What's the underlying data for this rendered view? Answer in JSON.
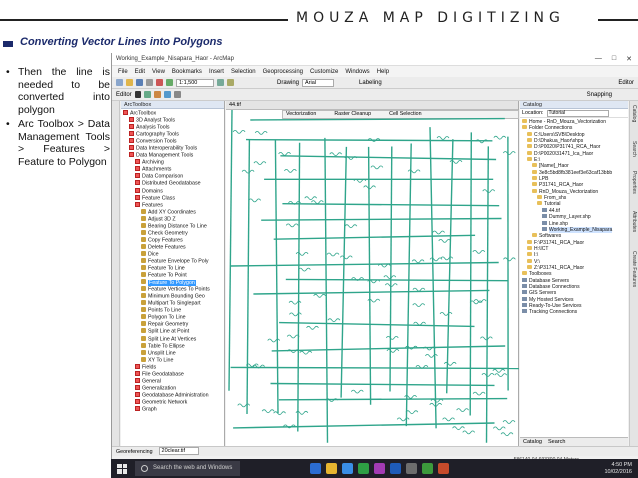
{
  "header": {
    "title": "MOUZA MAP DIGITIZING",
    "subtitle": "Converting Vector Lines into Polygons"
  },
  "bullets": [
    "Then the line is needed to be converted into polygon",
    "Arc Toolbox > Data Management Tools > Features > Feature to Polygon"
  ],
  "app": {
    "window_title": "Working_Example_Nisapara_Haor - ArcMap",
    "menu": [
      "File",
      "Edit",
      "View",
      "Bookmarks",
      "Insert",
      "Selection",
      "Geoprocessing",
      "Customize",
      "Windows",
      "Help"
    ],
    "scale": "1:1,500",
    "drawing_label": "Drawing",
    "font_name": "Arial",
    "labeling_label": "Labeling",
    "editor_label": "Editor",
    "snapping_label": "Snapping",
    "toolbox_title": "ArcToolbox",
    "toolbox_items": [
      {
        "label": "ArcToolbox",
        "indent": 0,
        "kind": "box"
      },
      {
        "label": "3D Analyst Tools",
        "indent": 1,
        "kind": "box"
      },
      {
        "label": "Analysis Tools",
        "indent": 1,
        "kind": "box"
      },
      {
        "label": "Cartography Tools",
        "indent": 1,
        "kind": "box"
      },
      {
        "label": "Conversion Tools",
        "indent": 1,
        "kind": "box"
      },
      {
        "label": "Data Interoperability Tools",
        "indent": 1,
        "kind": "box"
      },
      {
        "label": "Data Management Tools",
        "indent": 1,
        "kind": "box"
      },
      {
        "label": "Archiving",
        "indent": 2,
        "kind": "box"
      },
      {
        "label": "Attachments",
        "indent": 2,
        "kind": "box"
      },
      {
        "label": "Data Comparison",
        "indent": 2,
        "kind": "box"
      },
      {
        "label": "Distributed Geodatabase",
        "indent": 2,
        "kind": "box"
      },
      {
        "label": "Domains",
        "indent": 2,
        "kind": "box"
      },
      {
        "label": "Feature Class",
        "indent": 2,
        "kind": "box"
      },
      {
        "label": "Features",
        "indent": 2,
        "kind": "box"
      },
      {
        "label": "Add XY Coordinates",
        "indent": 3,
        "kind": "tool"
      },
      {
        "label": "Adjust 3D Z",
        "indent": 3,
        "kind": "tool"
      },
      {
        "label": "Bearing Distance To Line",
        "indent": 3,
        "kind": "tool"
      },
      {
        "label": "Check Geometry",
        "indent": 3,
        "kind": "tool"
      },
      {
        "label": "Copy Features",
        "indent": 3,
        "kind": "tool"
      },
      {
        "label": "Delete Features",
        "indent": 3,
        "kind": "tool"
      },
      {
        "label": "Dice",
        "indent": 3,
        "kind": "tool"
      },
      {
        "label": "Feature Envelope To Poly",
        "indent": 3,
        "kind": "tool"
      },
      {
        "label": "Feature To Line",
        "indent": 3,
        "kind": "tool"
      },
      {
        "label": "Feature To Point",
        "indent": 3,
        "kind": "tool"
      },
      {
        "label": "Feature To Polygon",
        "indent": 3,
        "kind": "tool",
        "selected": true
      },
      {
        "label": "Feature Vertices To Points",
        "indent": 3,
        "kind": "tool"
      },
      {
        "label": "Minimum Bounding Geo",
        "indent": 3,
        "kind": "tool"
      },
      {
        "label": "Multipart To Singlepart",
        "indent": 3,
        "kind": "tool"
      },
      {
        "label": "Points To Line",
        "indent": 3,
        "kind": "tool"
      },
      {
        "label": "Polygon To Line",
        "indent": 3,
        "kind": "tool"
      },
      {
        "label": "Repair Geometry",
        "indent": 3,
        "kind": "tool"
      },
      {
        "label": "Split Line at Point",
        "indent": 3,
        "kind": "tool"
      },
      {
        "label": "Split Line At Vertices",
        "indent": 3,
        "kind": "tool"
      },
      {
        "label": "Table To Ellipse",
        "indent": 3,
        "kind": "tool"
      },
      {
        "label": "Unsplit Line",
        "indent": 3,
        "kind": "tool"
      },
      {
        "label": "XY To Line",
        "indent": 3,
        "kind": "tool"
      },
      {
        "label": "Fields",
        "indent": 2,
        "kind": "box"
      },
      {
        "label": "File Geodatabase",
        "indent": 2,
        "kind": "box"
      },
      {
        "label": "General",
        "indent": 2,
        "kind": "box"
      },
      {
        "label": "Generalization",
        "indent": 2,
        "kind": "box"
      },
      {
        "label": "Geodatabase Administration",
        "indent": 2,
        "kind": "box"
      },
      {
        "label": "Geometric Network",
        "indent": 2,
        "kind": "box"
      },
      {
        "label": "Graph",
        "indent": 2,
        "kind": "box"
      }
    ],
    "map_tab": "44.tif",
    "vectorization_bar": [
      "Vectorization",
      "Raster Cleanup",
      "Cell Selection"
    ],
    "catalog_title": "Catalog",
    "location_label": "Location:",
    "location_value": "Tutorial",
    "catalog_items": [
      {
        "label": "Home - RnD_Mouza_Vectorization",
        "indent": 0,
        "kind": "folder"
      },
      {
        "label": "Folder Connections",
        "indent": 0,
        "kind": "folder"
      },
      {
        "label": "C:\\Users\\SVB\\Desktop",
        "indent": 1,
        "kind": "folder"
      },
      {
        "label": "D:\\Dhakua_Haor\\shps",
        "indent": 1,
        "kind": "folder"
      },
      {
        "label": "D:\\P0020\\P31741_RCA_Haor",
        "indent": 1,
        "kind": "folder"
      },
      {
        "label": "D:\\P0020\\31471_Ica_Haor",
        "indent": 1,
        "kind": "folder"
      },
      {
        "label": "E:\\",
        "indent": 1,
        "kind": "folder"
      },
      {
        "label": "[Name]_Haor",
        "indent": 2,
        "kind": "folder"
      },
      {
        "label": "3e8c5bd8fb381eef3e63caf13bbb",
        "indent": 2,
        "kind": "folder"
      },
      {
        "label": "LPB",
        "indent": 2,
        "kind": "folder"
      },
      {
        "label": "P31741_RCA_Haor",
        "indent": 2,
        "kind": "folder"
      },
      {
        "label": "RnD_Mouza_Vectorization",
        "indent": 2,
        "kind": "folder"
      },
      {
        "label": "From_shs",
        "indent": 3,
        "kind": "folder"
      },
      {
        "label": "Tutorial",
        "indent": 3,
        "kind": "folder"
      },
      {
        "label": "44.tif",
        "indent": 4,
        "kind": "data"
      },
      {
        "label": "Dummy_Layer.shp",
        "indent": 4,
        "kind": "data"
      },
      {
        "label": "Line.shp",
        "indent": 4,
        "kind": "data"
      },
      {
        "label": "Working_Example_Nisapara",
        "indent": 4,
        "kind": "data",
        "highlight": true
      },
      {
        "label": "Softwares",
        "indent": 2,
        "kind": "folder"
      },
      {
        "label": "F:\\P31741_RCA_Haor",
        "indent": 1,
        "kind": "folder"
      },
      {
        "label": "H:\\ICT",
        "indent": 1,
        "kind": "folder"
      },
      {
        "label": "I:\\",
        "indent": 1,
        "kind": "folder"
      },
      {
        "label": "V:\\",
        "indent": 1,
        "kind": "folder"
      },
      {
        "label": "Z:\\P31741_RCA_Haor",
        "indent": 1,
        "kind": "folder"
      },
      {
        "label": "Toolboxes",
        "indent": 0,
        "kind": "folder"
      },
      {
        "label": "Database Servers",
        "indent": 0,
        "kind": "data"
      },
      {
        "label": "Database Connections",
        "indent": 0,
        "kind": "data"
      },
      {
        "label": "GIS Servers",
        "indent": 0,
        "kind": "data"
      },
      {
        "label": "My Hosted Services",
        "indent": 0,
        "kind": "data"
      },
      {
        "label": "Ready-To-Use Services",
        "indent": 0,
        "kind": "data"
      },
      {
        "label": "Tracking Connections",
        "indent": 0,
        "kind": "data"
      }
    ],
    "catalog_tabs": [
      "Catalog",
      "Search"
    ],
    "right_tabs": [
      "Catalog",
      "Search",
      "Properties",
      "Attributes",
      "Create Features"
    ],
    "left_tabs": [
      "Attributes",
      "ArcToolbox"
    ],
    "georeferencing_label": "Georeferencing",
    "georef_layer": "20clear.tif",
    "status_coords": "586140.04 693300.04 Meters"
  },
  "taskbar": {
    "search_placeholder": "Search the web and Windows",
    "time": "4:50 PM",
    "date": "10/02/2016"
  },
  "colors": {
    "accent": "#1b2a6b",
    "selection": "#3399ff",
    "map_lines": "#2fa58b"
  }
}
